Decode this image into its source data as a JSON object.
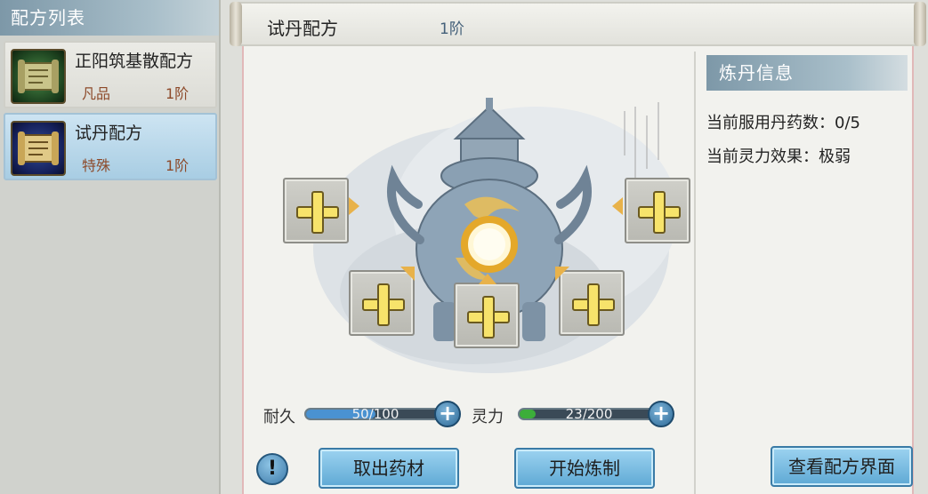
{
  "recipe_list": {
    "title": "配方列表",
    "items": [
      {
        "name": "正阳筑基散配方",
        "grade": "凡品",
        "level": "1阶",
        "icon": "green-scroll-icon"
      },
      {
        "name": "试丹配方",
        "grade": "特殊",
        "level": "1阶",
        "icon": "blue-scroll-icon",
        "selected": true
      }
    ]
  },
  "formula": {
    "title": "试丹配方",
    "level": "1阶"
  },
  "stats": {
    "durability": {
      "label": "耐久",
      "text": "50/100",
      "value": 50,
      "max": 100
    },
    "spirit": {
      "label": "灵力",
      "text": "23/200",
      "value": 23,
      "max": 200
    }
  },
  "buttons": {
    "take_out": "取出药材",
    "start": "开始炼制",
    "view_recipe": "查看配方界面",
    "info": "!"
  },
  "alchemy_info": {
    "title": "炼丹信息",
    "line1": "当前服用丹药数：0/5",
    "line2": "当前灵力效果：极弱"
  },
  "colors": {
    "accent_blue": "#5ea9d4",
    "durability_fill": "#4a92d1",
    "spirit_fill": "#3cae3a",
    "plus_yellow": "#f7e36b"
  }
}
